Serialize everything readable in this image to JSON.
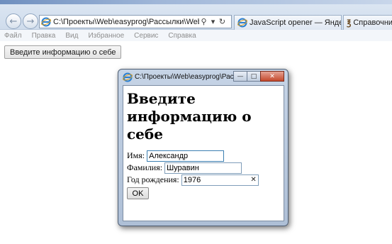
{
  "browser": {
    "address": "C:\\Проекты\\Web\\easyprog\\Рассылки\\Web-Програм",
    "tabs": [
      {
        "label": "JavaScript opener — Яндекс: н..."
      },
      {
        "label": "Справочник_"
      }
    ],
    "menu": [
      "Файл",
      "Правка",
      "Вид",
      "Избранное",
      "Сервис",
      "Справка"
    ]
  },
  "page": {
    "open_button_label": "Введите информацию о себе"
  },
  "popup": {
    "title": "C:\\Проекты\\Web\\easyprog\\Рас...",
    "heading": "Введите информацию о себе",
    "fields": {
      "name_label": "Имя:",
      "name_value": "Александр",
      "surname_label": "Фамилия:",
      "surname_value": "Шуравин",
      "birth_label": "Год рождения:",
      "birth_value": "1976"
    },
    "ok_label": "OK"
  },
  "colors": {
    "chrome": "#d5e1ef",
    "popup_frame": "#b8c8dc",
    "close_button": "#c4482c"
  }
}
